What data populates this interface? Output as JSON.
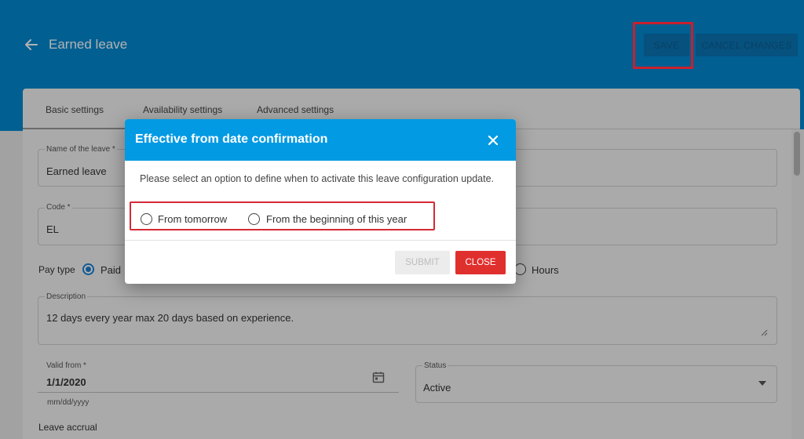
{
  "header": {
    "title": "Earned leave",
    "save_label": "SAVE",
    "cancel_label": "CANCEL CHANGES"
  },
  "tabs": [
    {
      "label": "Basic settings"
    },
    {
      "label": "Availability settings"
    },
    {
      "label": "Advanced settings"
    }
  ],
  "form": {
    "name_label": "Name of the leave *",
    "name_value": "Earned leave",
    "code_label": "Code *",
    "code_value": "EL",
    "pay_type_label": "Pay type",
    "pay_type_paid": "Paid",
    "unit_hours": "Hours",
    "description_label": "Description",
    "description_value": "12 days every year max 20 days based on experience.",
    "valid_from_label": "Valid from *",
    "valid_from_value": "1/1/2020",
    "valid_from_hint": "mm/dd/yyyy",
    "status_label": "Status",
    "status_value": "Active",
    "leave_accrual_label": "Leave accrual"
  },
  "dialog": {
    "title": "Effective from date confirmation",
    "message": "Please select an option to define when to activate this leave configuration update.",
    "options": [
      {
        "label": "From tomorrow"
      },
      {
        "label": "From the beginning of this year"
      }
    ],
    "submit_label": "SUBMIT",
    "close_label": "CLOSE"
  },
  "icons": {
    "back": "arrow-left-icon",
    "close": "close-icon",
    "calendar": "calendar-icon",
    "dropdown": "caret-down-icon",
    "resize": "resize-handle-icon"
  },
  "colors": {
    "header_blue": "#0289d1",
    "dialog_header_blue": "#029ae3",
    "close_button_red": "#e0302e",
    "highlight_red": "#c8202e",
    "radio_selected_blue": "#1a7fd0"
  }
}
